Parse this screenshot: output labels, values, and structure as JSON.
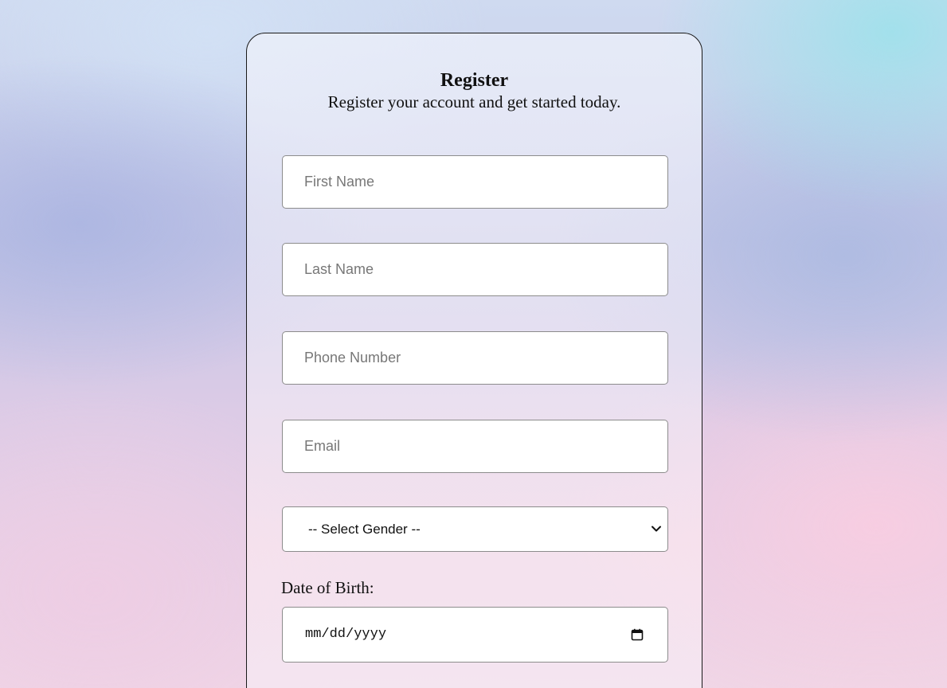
{
  "form": {
    "title": "Register",
    "subtitle": "Register your account and get started today.",
    "fields": {
      "first_name": {
        "placeholder": "First Name",
        "value": ""
      },
      "last_name": {
        "placeholder": "Last Name",
        "value": ""
      },
      "phone": {
        "placeholder": "Phone Number",
        "value": ""
      },
      "email": {
        "placeholder": "Email",
        "value": ""
      }
    },
    "gender": {
      "selected": "-- Select Gender --",
      "icon": "chevron-down-icon"
    },
    "dob": {
      "label": "Date of Birth:",
      "value": "mm/dd/yyyy",
      "icon": "calendar-icon"
    }
  }
}
